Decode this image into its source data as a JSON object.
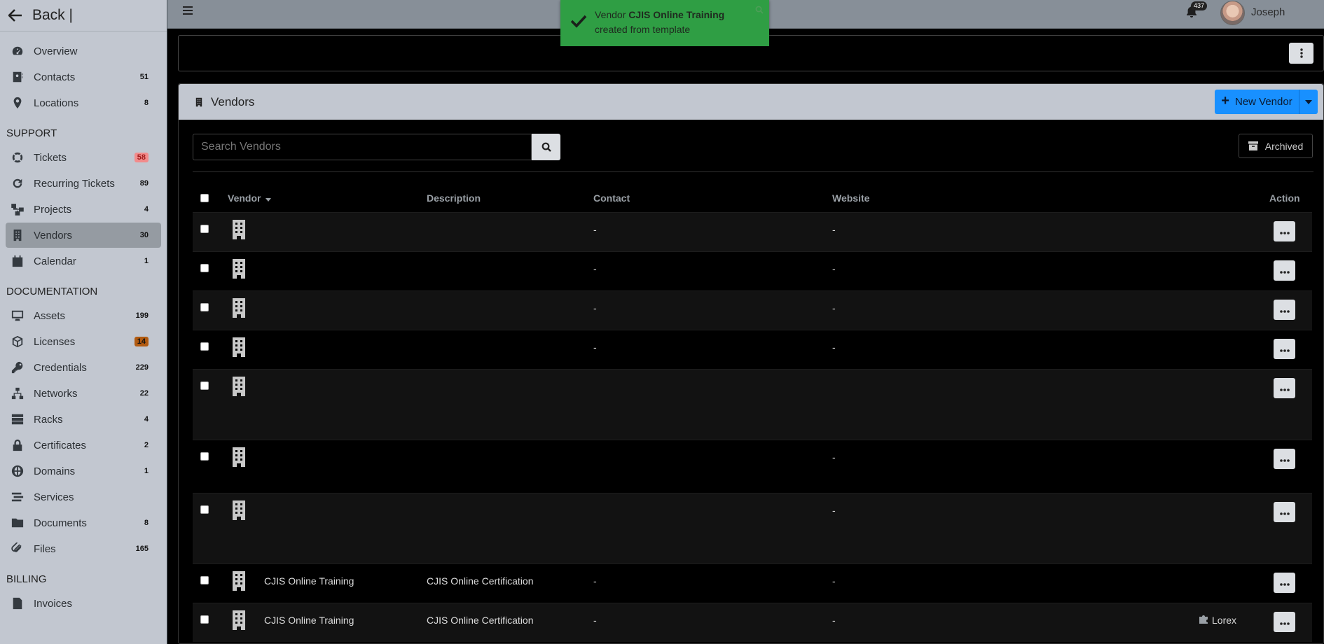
{
  "sidebar": {
    "back_label": "Back |",
    "items": [
      {
        "label": "Overview",
        "icon": "dashboard-icon"
      },
      {
        "label": "Contacts",
        "icon": "address-book-icon",
        "count": "51"
      },
      {
        "label": "Locations",
        "icon": "map-marker-icon",
        "count": "8"
      }
    ],
    "support_header": "SUPPORT",
    "support": [
      {
        "label": "Tickets",
        "icon": "life-ring-icon",
        "count": "58",
        "count_color": "#f28b8b"
      },
      {
        "label": "Recurring Tickets",
        "icon": "redo-icon",
        "count": "89"
      },
      {
        "label": "Projects",
        "icon": "project-diagram-icon",
        "count": "4"
      },
      {
        "label": "Vendors",
        "icon": "building-icon",
        "count": "30",
        "active": true
      },
      {
        "label": "Calendar",
        "icon": "calendar-icon",
        "count": "1"
      }
    ],
    "documentation_header": "DOCUMENTATION",
    "documentation": [
      {
        "label": "Assets",
        "icon": "desktop-icon",
        "count": "199"
      },
      {
        "label": "Licenses",
        "icon": "cube-icon",
        "count": "14",
        "count_color": "#b15a10"
      },
      {
        "label": "Credentials",
        "icon": "key-icon",
        "count": "229"
      },
      {
        "label": "Networks",
        "icon": "network-icon",
        "count": "22"
      },
      {
        "label": "Racks",
        "icon": "server-icon",
        "count": "4"
      },
      {
        "label": "Certificates",
        "icon": "lock-icon",
        "count": "2"
      },
      {
        "label": "Domains",
        "icon": "globe-icon",
        "count": "1"
      },
      {
        "label": "Services",
        "icon": "stream-icon"
      },
      {
        "label": "Documents",
        "icon": "folder-icon",
        "count": "8"
      },
      {
        "label": "Files",
        "icon": "paperclip-icon",
        "count": "165"
      }
    ],
    "billing_header": "BILLING",
    "billing": [
      {
        "label": "Invoices",
        "icon": "invoice-icon"
      }
    ]
  },
  "topbar": {
    "notification_count": "437",
    "username": "Joseph"
  },
  "toast": {
    "prefix": "Vendor ",
    "name": "CJIS Online Training",
    "suffix": "created from template"
  },
  "card": {
    "title": "Vendors",
    "new_button": "New Vendor",
    "search_placeholder": "Search Vendors",
    "archived_button": "Archived"
  },
  "table": {
    "columns": {
      "vendor": "Vendor",
      "description": "Description",
      "contact": "Contact",
      "website": "Website",
      "action": "Action"
    },
    "rows": [
      {
        "vendor": "",
        "description": "",
        "contact": "-",
        "website": "-",
        "tag": ""
      },
      {
        "vendor": "",
        "description": "",
        "contact": "-",
        "website": "-",
        "tag": ""
      },
      {
        "vendor": "",
        "description": "",
        "contact": "-",
        "website": "-",
        "tag": ""
      },
      {
        "vendor": "",
        "description": "",
        "contact": "-",
        "website": "-",
        "tag": ""
      },
      {
        "vendor": "",
        "description": "",
        "contact": "",
        "website": "",
        "tag": ""
      },
      {
        "vendor": "",
        "description": "",
        "contact": "",
        "website": "-",
        "tag": ""
      },
      {
        "vendor": "",
        "description": "",
        "contact": "",
        "website": "-",
        "tag": ""
      },
      {
        "vendor": "CJIS Online Training",
        "description": "CJIS Online Certification",
        "contact": "-",
        "website": "-",
        "tag": ""
      },
      {
        "vendor": "CJIS Online Training",
        "description": "CJIS Online Certification",
        "contact": "-",
        "website": "-",
        "tag": "Lorex"
      }
    ]
  }
}
